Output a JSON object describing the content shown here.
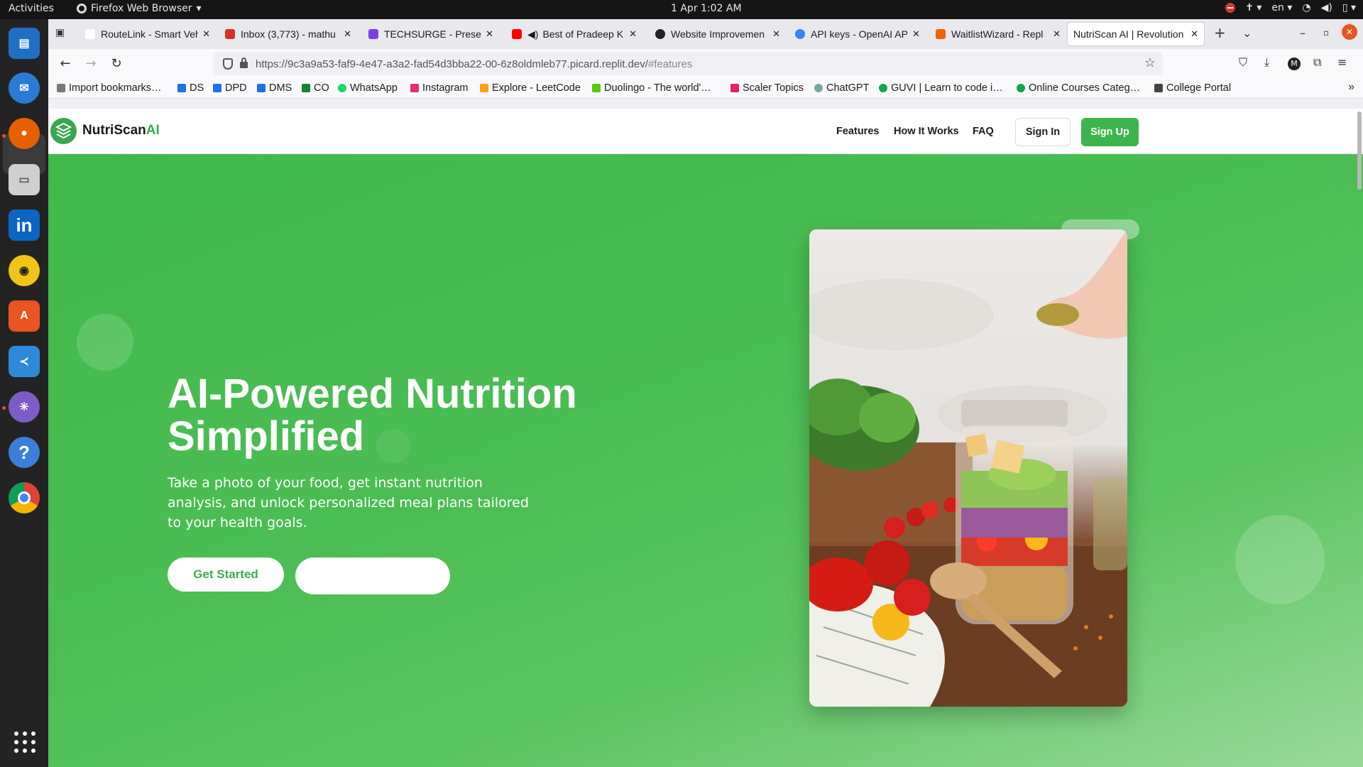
{
  "system": {
    "activities": "Activities",
    "app_name": "Firefox Web Browser",
    "clock": "1 Apr  1:02 AM",
    "lang": "en"
  },
  "tabs": [
    {
      "title": "RouteLink - Smart Vehicl",
      "color": "#ffffff"
    },
    {
      "title": "Inbox (3,773) - mathu",
      "color": "#d93025"
    },
    {
      "title": "TECHSURGE - Presen",
      "color": "#7b3fe4"
    },
    {
      "title": "Best of Pradeep K",
      "color": "#ff0000"
    },
    {
      "title": "Website Improvemen",
      "color": "#222222"
    },
    {
      "title": "API keys - OpenAI API",
      "color": "#3b82f6"
    },
    {
      "title": "WaitlistWizard - Repl",
      "color": "#f26207"
    },
    {
      "title": "NutriScan AI | Revolution",
      "color": "#ffffff"
    }
  ],
  "address": {
    "url_main": "https://9c3a9a53-faf9-4e47-a3a2-fad54d3bba22-00-6z8oldmleb77.picard.replit.dev/",
    "url_hash": "#features"
  },
  "bookmarks": [
    {
      "label": "Import bookmarks…",
      "color": "#555555"
    },
    {
      "label": "DS",
      "color": "#1a73e8"
    },
    {
      "label": "DPD",
      "color": "#1a73e8"
    },
    {
      "label": "DMS",
      "color": "#1a73e8"
    },
    {
      "label": "CO",
      "color": "#188038"
    },
    {
      "label": "WhatsApp",
      "color": "#25d366"
    },
    {
      "label": "Instagram",
      "color": "#e1306c"
    },
    {
      "label": "Explore - LeetCode",
      "color": "#ffa116"
    },
    {
      "label": "Duolingo - The world'…",
      "color": "#58cc02"
    },
    {
      "label": "Scaler Topics",
      "color": "#e91e63"
    },
    {
      "label": "ChatGPT",
      "color": "#74aa9c"
    },
    {
      "label": "GUVI | Learn to code i…",
      "color": "#10a64a"
    },
    {
      "label": "Online Courses Categ…",
      "color": "#10a64a"
    },
    {
      "label": "College Portal",
      "color": "#444444"
    }
  ],
  "site": {
    "brand_prefix": "NutriScan",
    "brand_suffix": "AI",
    "nav": [
      "Features",
      "How It Works",
      "FAQ"
    ],
    "sign_in": "Sign In",
    "sign_up": "Sign Up",
    "hero_title_line1": "AI-Powered Nutrition",
    "hero_title_line2": "Simplified",
    "hero_text": "Take a photo of your food, get instant nutrition analysis, and unlock personalized meal plans tailored to your health goals.",
    "cta_primary": "Get Started",
    "cta_secondary": ""
  },
  "colors": {
    "brand_green": "#3cb54e",
    "hero_green": "#41b94c"
  }
}
